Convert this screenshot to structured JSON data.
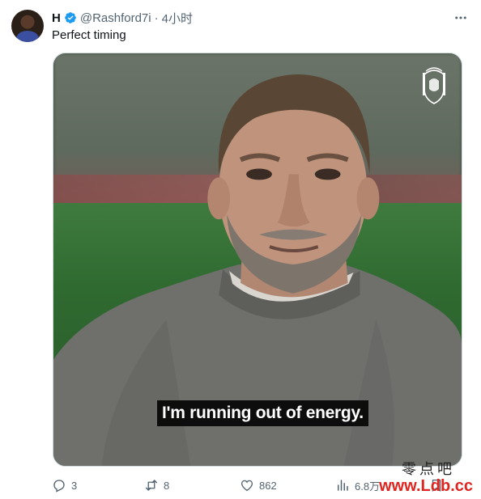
{
  "tweet": {
    "display_name": "H",
    "handle": "@Rashford7i",
    "separator": "·",
    "time": "4小时",
    "text": "Perfect timing"
  },
  "media": {
    "subtitle": "I'm running out of energy.",
    "crest_icon": "liverpool-crest-icon"
  },
  "actions": {
    "replies": "3",
    "retweets": "8",
    "likes": "862",
    "views": "6.8万"
  },
  "watermark": {
    "top": "零点吧",
    "bottom": "www.Ldb.cc"
  },
  "colors": {
    "verified": "#1d9bf0",
    "secondary_text": "#536471",
    "primary_text": "#0f1419",
    "subtitle_bg": "#000000",
    "watermark_red": "#e0241f"
  }
}
